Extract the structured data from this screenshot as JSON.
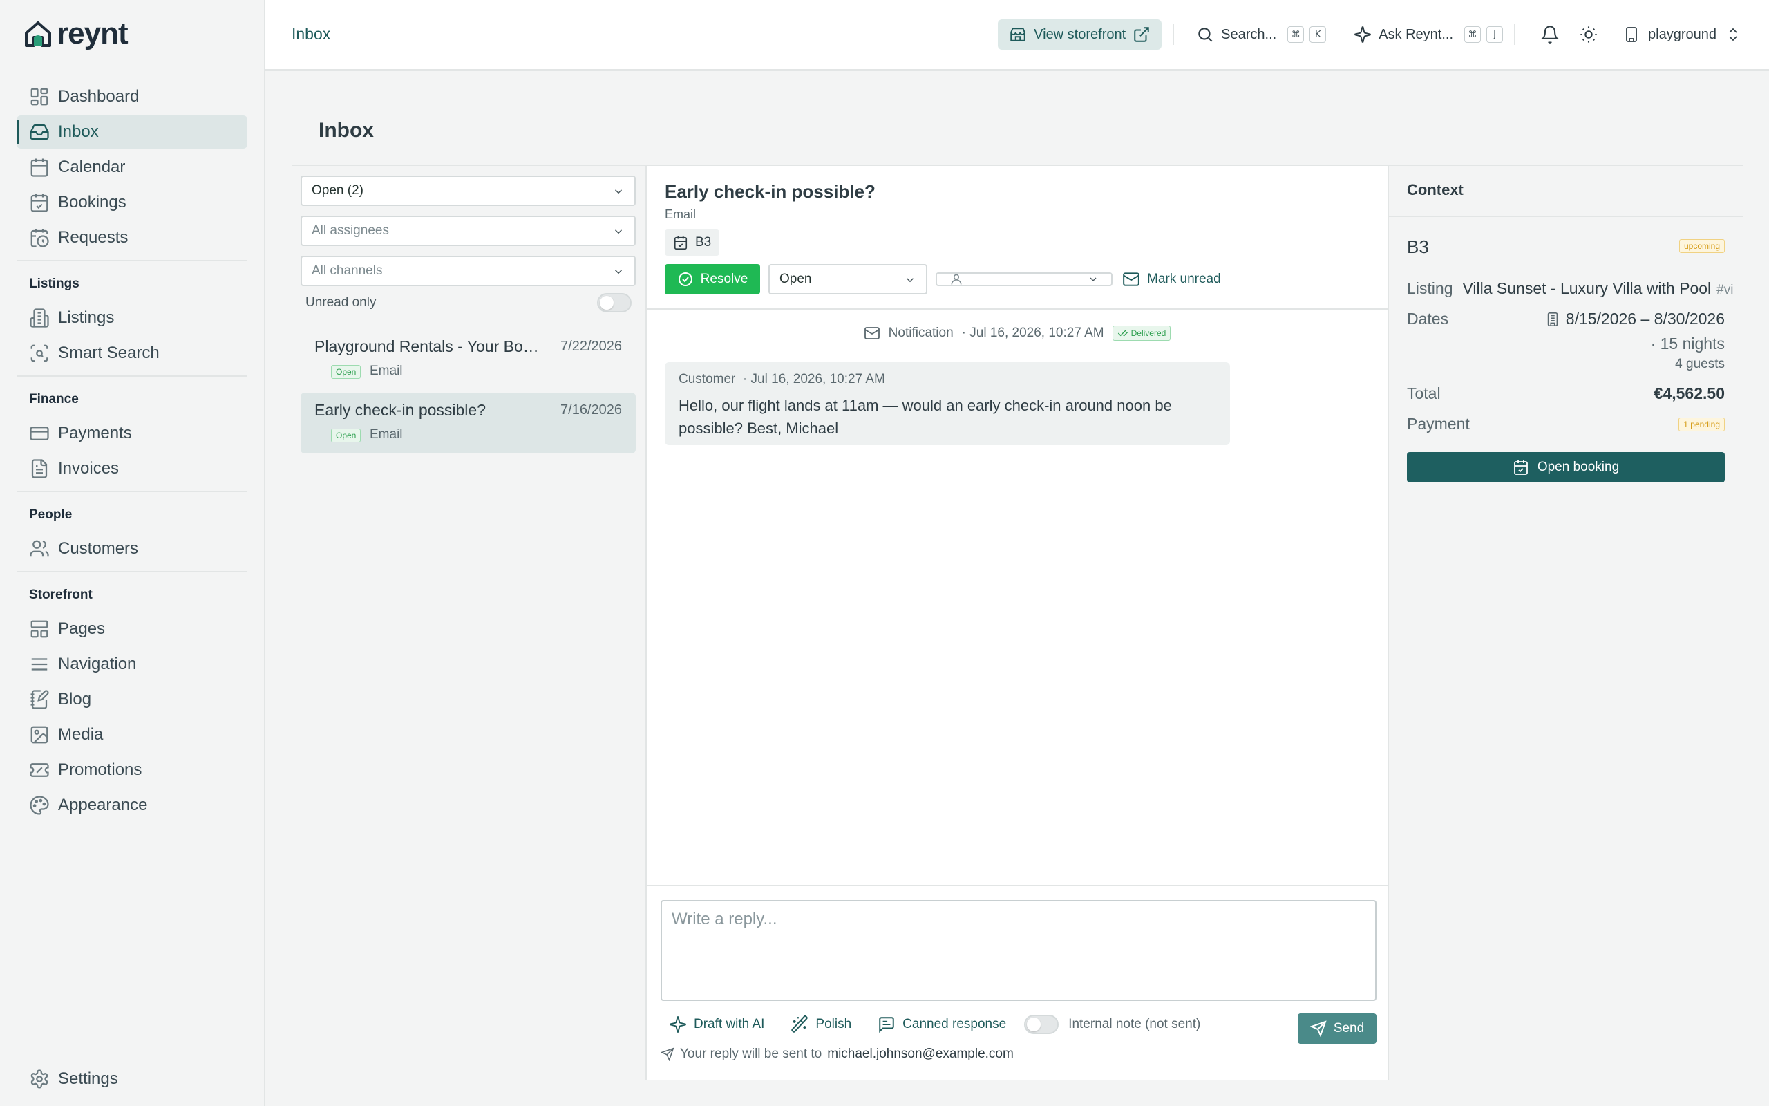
{
  "app": {
    "logo_text": "reynt"
  },
  "sidebar": {
    "items_main": [
      {
        "label": "Dashboard",
        "icon": "dashboard-icon"
      },
      {
        "label": "Inbox",
        "icon": "inbox-icon"
      },
      {
        "label": "Calendar",
        "icon": "calendar-icon"
      },
      {
        "label": "Bookings",
        "icon": "calendar-check-icon"
      },
      {
        "label": "Requests",
        "icon": "clock-icon"
      }
    ],
    "sections": [
      {
        "heading": "Listings",
        "items": [
          {
            "label": "Listings",
            "icon": "building-icon"
          },
          {
            "label": "Smart Search",
            "icon": "scan-search-icon"
          }
        ]
      },
      {
        "heading": "Finance",
        "items": [
          {
            "label": "Payments",
            "icon": "credit-card-icon"
          },
          {
            "label": "Invoices",
            "icon": "file-text-icon"
          }
        ]
      },
      {
        "heading": "People",
        "items": [
          {
            "label": "Customers",
            "icon": "users-icon"
          }
        ]
      },
      {
        "heading": "Storefront",
        "items": [
          {
            "label": "Pages",
            "icon": "layout-icon"
          },
          {
            "label": "Navigation",
            "icon": "menu-icon"
          },
          {
            "label": "Blog",
            "icon": "notebook-pen-icon"
          },
          {
            "label": "Media",
            "icon": "image-icon"
          },
          {
            "label": "Promotions",
            "icon": "ticket-icon"
          },
          {
            "label": "Appearance",
            "icon": "palette-icon"
          }
        ]
      }
    ],
    "settings_label": "Settings",
    "active": "Inbox"
  },
  "topbar": {
    "breadcrumb": "Inbox",
    "storefront_label": "View storefront",
    "search_label": "Search...",
    "search_keys": [
      "⌘",
      "K"
    ],
    "ask_label": "Ask Reynt...",
    "ask_keys": [
      "⌘",
      "J"
    ],
    "workspace": "playground"
  },
  "page": {
    "title": "Inbox"
  },
  "filters": {
    "status": "Open (2)",
    "assignees_placeholder": "All assignees",
    "channels_placeholder": "All channels",
    "unread_only_label": "Unread only"
  },
  "conversations": [
    {
      "title": "Playground Rentals - Your Boo...",
      "date": "7/22/2026",
      "status": "Open",
      "channel": "Email"
    },
    {
      "title": "Early check-in possible?",
      "date": "7/16/2026",
      "status": "Open",
      "channel": "Email"
    }
  ],
  "conversation": {
    "title": "Early check-in possible?",
    "channel": "Email",
    "booking_chip": "B3",
    "resolve_label": "Resolve",
    "status_value": "Open",
    "mark_unread_label": "Mark unread",
    "notification": {
      "label": "Notification",
      "time": "· Jul 16, 2026, 10:27 AM",
      "status": "Delivered"
    },
    "message": {
      "author": "Customer",
      "time": "· Jul 16, 2026, 10:27 AM",
      "body": "Hello, our flight lands at 11am — would an early check-in around noon be possible? Best, Michael"
    },
    "reply": {
      "placeholder": "Write a reply...",
      "draft_ai_label": "Draft with AI",
      "polish_label": "Polish",
      "canned_label": "Canned response",
      "internal_note_label": "Internal note (not sent)",
      "send_label": "Send",
      "recipient_prefix": "Your reply will be sent to",
      "recipient_email": "michael.johnson@example.com"
    }
  },
  "context": {
    "heading": "Context",
    "booking_code": "B3",
    "booking_status": "upcoming",
    "listing_label": "Listing",
    "listing_value": "Villa Sunset - Luxury Villa with Pool",
    "listing_id": "#vi",
    "dates_label": "Dates",
    "dates_value": "8/15/2026 – 8/30/2026",
    "nights": "· 15 nights",
    "guests": "4 guests",
    "total_label": "Total",
    "total_value": "€4,562.50",
    "payment_label": "Payment",
    "payment_status": "1 pending",
    "open_booking_label": "Open booking"
  },
  "colors": {
    "accent": "#1e5a5a",
    "success": "#1fb954",
    "warning": "#d49a12"
  }
}
